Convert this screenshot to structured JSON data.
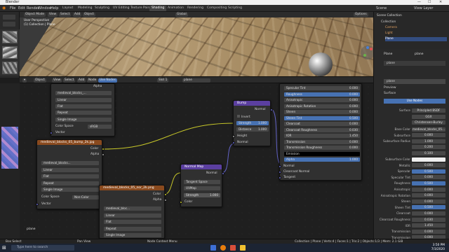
{
  "titlebar": {
    "title": "Blender",
    "min": "—",
    "max": "☐",
    "close": "✕"
  },
  "menubar": {
    "file": "File",
    "edit": "Edit",
    "render": "Render",
    "window": "Window",
    "help": "Help",
    "tabs": [
      "Layout",
      "Modeling",
      "Sculpting",
      "UV Editing",
      "Texture Paint",
      "Shading",
      "Animation",
      "Rendering",
      "Compositing",
      "Scripting"
    ],
    "active_tab": "Shading",
    "scene": "Scene",
    "view_layer": "View Layer"
  },
  "viewport": {
    "mode": "Object Mode",
    "view": "View",
    "select": "Select",
    "add": "Add",
    "object": "Object",
    "info1": "User Perspective",
    "info2": "(1) Collection | Plane",
    "shading": "Global",
    "options": "Options"
  },
  "node_editor": {
    "object": "Object",
    "view": "View",
    "select": "Select",
    "add": "Add",
    "node": "Node",
    "use_nodes": "Use Nodes",
    "slot": "Slot 1",
    "material": "plane",
    "label": "plane"
  },
  "nodes": {
    "top_img": {
      "file": "medieval_blocks_...",
      "opt1": "Linear",
      "opt2": "Flat",
      "opt3": "Repeat",
      "opt4": "Single Image",
      "cs_label": "Color Space",
      "cs_val": "sRGB",
      "vector": "Vector",
      "alpha": "Alpha"
    },
    "bump_img": {
      "title": "medieval_blocks_05_bump_2k.jpg",
      "color": "Color",
      "alpha": "Alpha",
      "file": "medieval_blocks...",
      "opt1": "Linear",
      "opt2": "Flat",
      "opt3": "Repeat",
      "opt4": "Single Image",
      "cs_label": "Color Space",
      "cs_val": "Non-Color",
      "vector": "Vector"
    },
    "nor_img": {
      "title": "medieval_blocks_05_nor_2k.png",
      "color": "Color",
      "alpha": "Alpha",
      "file": "medieval_bloc...",
      "opt1": "Linear",
      "opt2": "Flat",
      "opt3": "Repeat",
      "opt4": "Single Image"
    },
    "bump": {
      "title": "Bump",
      "normal": "Normal",
      "invert": "Invert",
      "strength": "Strength",
      "strength_val": "1.000",
      "distance": "Distance",
      "distance_val": "1.000",
      "height": "Height",
      "normal_in": "Normal"
    },
    "normal_map": {
      "title": "Normal Map",
      "normal": "Normal",
      "space": "Tangent Space",
      "uvmap": "UVMap",
      "strength": "Strength",
      "strength_val": "1.000",
      "color": "Color"
    },
    "bsdf": {
      "rows": [
        [
          "Specular Tint",
          "0.000"
        ],
        [
          "Roughness",
          "0.000"
        ],
        [
          "Anisotropic",
          "0.000"
        ],
        [
          "Anisotropic Rotation",
          "0.000"
        ],
        [
          "Sheen",
          "0.000"
        ],
        [
          "Sheen Tint",
          "0.500"
        ],
        [
          "Clearcoat",
          "0.000"
        ],
        [
          "Clearcoat Roughness",
          "0.030"
        ],
        [
          "IOR",
          "1.450"
        ],
        [
          "Transmission",
          "0.000"
        ],
        [
          "Transmission Roughness",
          "0.000"
        ],
        [
          "Emission",
          ""
        ],
        [
          "Alpha",
          "1.000"
        ]
      ],
      "normal": "Normal",
      "cc_normal": "Clearcoat Normal",
      "tangent": "Tangent"
    }
  },
  "outliner": {
    "title": "Scene Collection",
    "rows": [
      "Collection",
      "Camera",
      "Light",
      "Plane"
    ]
  },
  "properties": {
    "object": "Plane",
    "material": "plane",
    "slot": "plane",
    "preview": "Preview",
    "surface": "Surface",
    "use_nodes": "Use Nodes",
    "surface_val": "Principled BSDF",
    "gx": "GGX",
    "sss": "Christensen-Burley",
    "rows": [
      [
        "Base Color",
        "medieval_blocks_05..."
      ],
      [
        "Subsurface",
        "0.000"
      ],
      [
        "Subsurface Radius",
        "1.000"
      ],
      [
        "",
        "0.200"
      ],
      [
        "",
        "0.100"
      ],
      [
        "Subsurface Color",
        ""
      ],
      [
        "Metallic",
        "0.000"
      ],
      [
        "Specular",
        "0.500"
      ],
      [
        "Specular Tint",
        "0.000"
      ],
      [
        "Roughness",
        "0.500"
      ],
      [
        "Anisotropic",
        "0.000"
      ],
      [
        "Anisotropic Rotation",
        "0.000"
      ],
      [
        "Sheen",
        "0.000"
      ],
      [
        "Sheen Tint",
        "0.500"
      ],
      [
        "Clearcoat",
        "0.000"
      ],
      [
        "Clearcoat Roughness",
        "0.030"
      ],
      [
        "IOR",
        "1.450"
      ],
      [
        "Transmission",
        "0.000"
      ],
      [
        "Transmission Roughness",
        "0.000"
      ]
    ]
  },
  "status": {
    "left": "Box Select",
    "mid": "Pan View",
    "right": "Node Context Menu",
    "info": "Collection | Plane | Verts:4 | Faces:1 | Tris:2 | Objects:1/3 | Mem: 2.1 GiB"
  },
  "taskbar": {
    "search": "Type here to search",
    "time": "3:50 PM",
    "date": "7/3/2020"
  }
}
